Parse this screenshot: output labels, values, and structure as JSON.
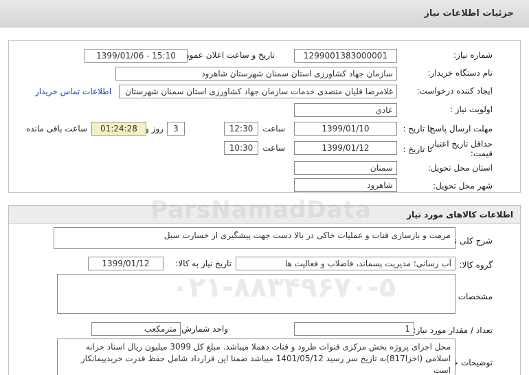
{
  "header": {
    "title": "جزئیات اطلاعات نیاز"
  },
  "need_info": {
    "need_number_label": "شماره نیاز:",
    "need_number": "1299001383000001",
    "announce_label": "تاریخ و ساعت اعلان عمومی:",
    "announce_value": "1399/01/06 - 15:10",
    "buyer_org_label": "نام دستگاه خریدار:",
    "buyer_org": "سازمان جهاد کشاورزی استان سمنان شهرستان شاهرود",
    "requester_label": "ایجاد کننده درخواست:",
    "requester": "غلامرضا قلیان متصدی خدمات سازمان جهاد کشاورزی استان سمنان شهرستان",
    "contact_link": "اطلاعات تماس خریدار",
    "priority_label": "اولویت نیاز :",
    "priority": "عادی",
    "reply_deadline_label": "مهلت ارسال پاسخ:",
    "to_date_label": "تا تاریخ :",
    "reply_date": "1399/01/10",
    "hour_label": "ساعت",
    "reply_time": "12:30",
    "days_value": "3",
    "days_label": "روز و",
    "remaining_time": "01:24:28",
    "remaining_label": "ساعت باقی مانده",
    "price_validity_label": "حداقل تاریخ اعتبار قیمت:",
    "price_date": "1399/01/12",
    "price_time": "10:30",
    "province_label": "استان محل تحویل:",
    "province": "سمنان",
    "city_label": "شهر محل تحویل:",
    "city": "شاهرود"
  },
  "goods_info": {
    "section_title": "اطلاعات کالاهای مورد نیاز",
    "desc_label": "شرح کلی نیاز:",
    "desc": "مرمت و بازسازی قنات و عملیات خاکی در بالا دست جهت پیشگیری از خسارت سیل",
    "group_label": "گروه کالا:",
    "group": "آب رسانی؛ مدیریت پسماند، فاضلاب و فعالیت ها",
    "need_date_label": "تاریخ نیاز به کالا:",
    "need_date": "1399/01/12",
    "spec_label": "مشخصات کالای مورد نیاز:",
    "spec": "",
    "qty_label": "تعداد / مقدار مورد نیاز:",
    "qty": "1",
    "unit_label": "واحد شمارش:",
    "unit": "مترمکعب",
    "buyer_notes_label": "توضیحات خریدار:",
    "buyer_notes": "محل اجرای پروژه بخش مرکزی قنوات طرود و قنات دهملا میباشد. مبلغ کل 3099 میلیون ریال اسناد خزانه اسلامی (اخزا817)به تاریخ سر رسید 1401/05/12 میباشد ضمنا این قرارداد شامل حفظ قدرت خریدپیمانکار است"
  },
  "watermark": {
    "text1": "ParsNamadData",
    "text2": "۰۲۱-۸۸۳۴۹۶۷۰-۵"
  }
}
